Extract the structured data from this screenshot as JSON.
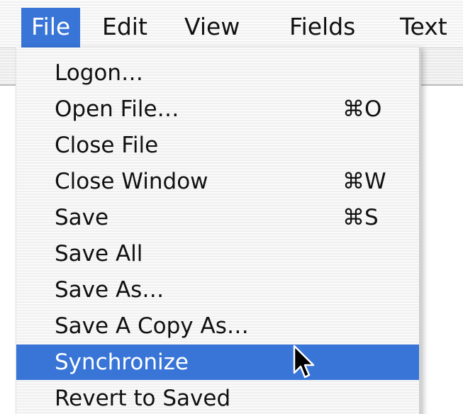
{
  "menubar": {
    "items": [
      {
        "label": "File",
        "active": true
      },
      {
        "label": "Edit",
        "active": false
      },
      {
        "label": "View",
        "active": false
      },
      {
        "label": "Fields",
        "active": false
      },
      {
        "label": "Text",
        "active": false
      }
    ]
  },
  "file_menu": {
    "items": [
      {
        "label": "Logon…",
        "shortcut": ""
      },
      {
        "label": "Open File…",
        "shortcut": "⌘O"
      },
      {
        "label": "Close File",
        "shortcut": ""
      },
      {
        "label": "Close Window",
        "shortcut": "⌘W"
      },
      {
        "label": "Save",
        "shortcut": "⌘S"
      },
      {
        "label": "Save All",
        "shortcut": ""
      },
      {
        "label": "Save As…",
        "shortcut": ""
      },
      {
        "label": "Save A Copy As…",
        "shortcut": ""
      },
      {
        "label": "Synchronize",
        "shortcut": "",
        "highlighted": true
      },
      {
        "label": "Revert to Saved",
        "shortcut": ""
      }
    ]
  },
  "colors": {
    "highlight": "#3875d7",
    "menu_text": "#111111",
    "highlight_text": "#ffffff"
  },
  "cursor": {
    "icon": "arrow-pointer-icon"
  }
}
